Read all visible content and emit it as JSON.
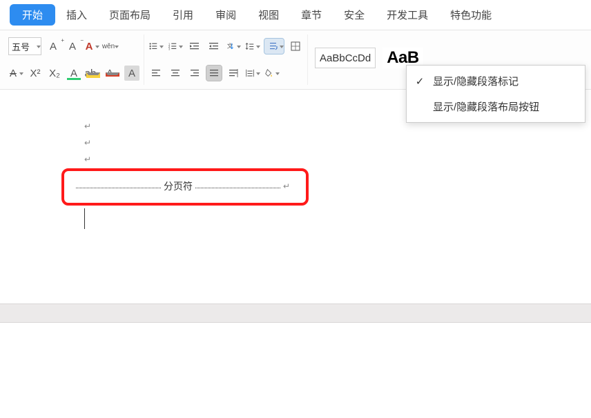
{
  "tabs": {
    "active": "开始",
    "insert": "插入",
    "layout": "页面布局",
    "reference": "引用",
    "review": "审阅",
    "view": "视图",
    "chapter": "章节",
    "security": "安全",
    "devtools": "开发工具",
    "special": "特色功能"
  },
  "ribbon": {
    "font_size": "五号",
    "style_normal": "AaBbCcDd",
    "style_heading_partial": "AaB",
    "font_grow_label": "A",
    "font_shrink_label": "A",
    "clear_format_label": "A",
    "pinyin_label": "wěn",
    "strike_label": "A",
    "superscript_label": "X²",
    "subscript_label": "X₂",
    "font_outline_label": "A",
    "highlight_label": "ab",
    "font_color_label": "A",
    "shading_label": "A"
  },
  "menu": {
    "item1": "显示/隐藏段落标记",
    "item2": "显示/隐藏段落布局按钮"
  },
  "document": {
    "page_break_label": "分页符"
  }
}
